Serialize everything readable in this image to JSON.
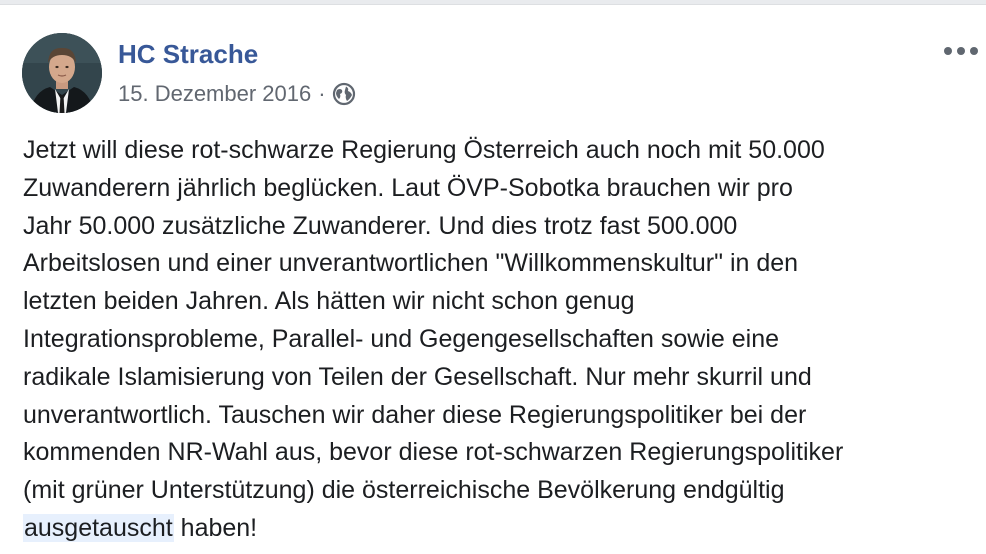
{
  "post": {
    "author": "HC Strache",
    "date": "15. Dezember 2016",
    "separator": "·",
    "privacy_icon": "globe-icon",
    "more_icon": "more-options-icon",
    "text_lines": [
      "Jetzt will diese rot-schwarze Regierung Österreich auch noch mit 50.000",
      "Zuwanderern jährlich beglücken. Laut ÖVP-Sobotka brauchen wir pro",
      "Jahr 50.000 zusätzliche Zuwanderer. Und dies trotz fast 500.000",
      "Arbeitslosen und einer unverantwortlichen \"Willkommenskultur\" in den",
      "letzten beiden Jahren. Als hätten wir nicht schon genug",
      "Integrationsprobleme, Parallel- und Gegengesellschaften sowie eine",
      "radikale Islamisierung von Teilen der Gesellschaft. Nur mehr skurril und",
      "unverantwortlich. Tauschen wir daher diese Regierungspolitiker bei der",
      "kommenden NR-Wahl aus, bevor diese rot-schwarzen Regierungspolitiker",
      "(mit grüner Unterstützung) die österreichische Bevölkerung endgültig"
    ],
    "last_line_highlight": "ausgetauscht",
    "last_line_rest": " haben!"
  },
  "colors": {
    "author_link": "#385898",
    "meta_text": "#616770",
    "body_text": "#1c1e21",
    "highlight": "#e7f0fd"
  }
}
